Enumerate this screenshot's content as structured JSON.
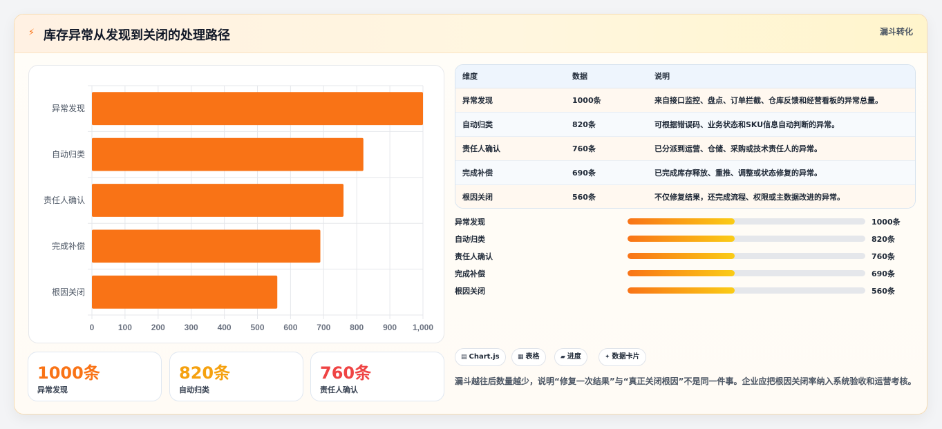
{
  "header": {
    "icon": "lightning-icon",
    "title": "库存异常从发现到关闭的处理路径",
    "tag": "漏斗转化"
  },
  "colors": {
    "bar": "#f97316",
    "kpi": [
      "#f97316",
      "#f5a10f",
      "#ef4444"
    ],
    "progress_start": "#f97316",
    "progress_end": "#facc15"
  },
  "chart_data": {
    "type": "bar",
    "orientation": "horizontal",
    "categories": [
      "异常发现",
      "自动归类",
      "责任人确认",
      "完成补偿",
      "根因关闭"
    ],
    "values": [
      1000,
      820,
      760,
      690,
      560
    ],
    "xlim": [
      0,
      1000
    ],
    "xticks": [
      "0",
      "100",
      "200",
      "300",
      "400",
      "500",
      "600",
      "700",
      "800",
      "900",
      "1,000"
    ],
    "grid": true
  },
  "kpis": [
    {
      "value": "1000条",
      "label": "异常发现"
    },
    {
      "value": "820条",
      "label": "自动归类"
    },
    {
      "value": "760条",
      "label": "责任人确认"
    }
  ],
  "table": {
    "headers": [
      "维度",
      "数据",
      "说明"
    ],
    "rows": [
      [
        "异常发现",
        "1000条",
        "来自接口监控、盘点、订单拦截、仓库反馈和经营看板的异常总量。"
      ],
      [
        "自动归类",
        "820条",
        "可根据错误码、业务状态和SKU信息自动判断的异常。"
      ],
      [
        "责任人确认",
        "760条",
        "已分派到运营、仓储、采购或技术责任人的异常。"
      ],
      [
        "完成补偿",
        "690条",
        "已完成库存释放、重推、调整或状态修复的异常。"
      ],
      [
        "根因关闭",
        "560条",
        "不仅修复结果，还完成流程、权限或主数据改进的异常。"
      ]
    ]
  },
  "progress": [
    {
      "label": "异常发现",
      "value": "1000条",
      "fill": 0.45
    },
    {
      "label": "自动归类",
      "value": "820条",
      "fill": 0.45
    },
    {
      "label": "责任人确认",
      "value": "760条",
      "fill": 0.45
    },
    {
      "label": "完成补偿",
      "value": "690条",
      "fill": 0.45
    },
    {
      "label": "根因关闭",
      "value": "560条",
      "fill": 0.45
    }
  ],
  "pills": [
    {
      "icon": "chart-icon",
      "glyph": "▤",
      "label": "Chart.js"
    },
    {
      "icon": "table-icon",
      "glyph": "▦",
      "label": "表格"
    },
    {
      "icon": "progress-icon",
      "glyph": "▰",
      "label": "进度"
    },
    {
      "icon": "sparkle-icon",
      "glyph": "✦",
      "label": "数据卡片"
    }
  ],
  "note": "漏斗越往后数量越少，说明“修复一次结果”与“真正关闭根因”不是同一件事。企业应把根因关闭率纳入系统验收和运营考核。"
}
